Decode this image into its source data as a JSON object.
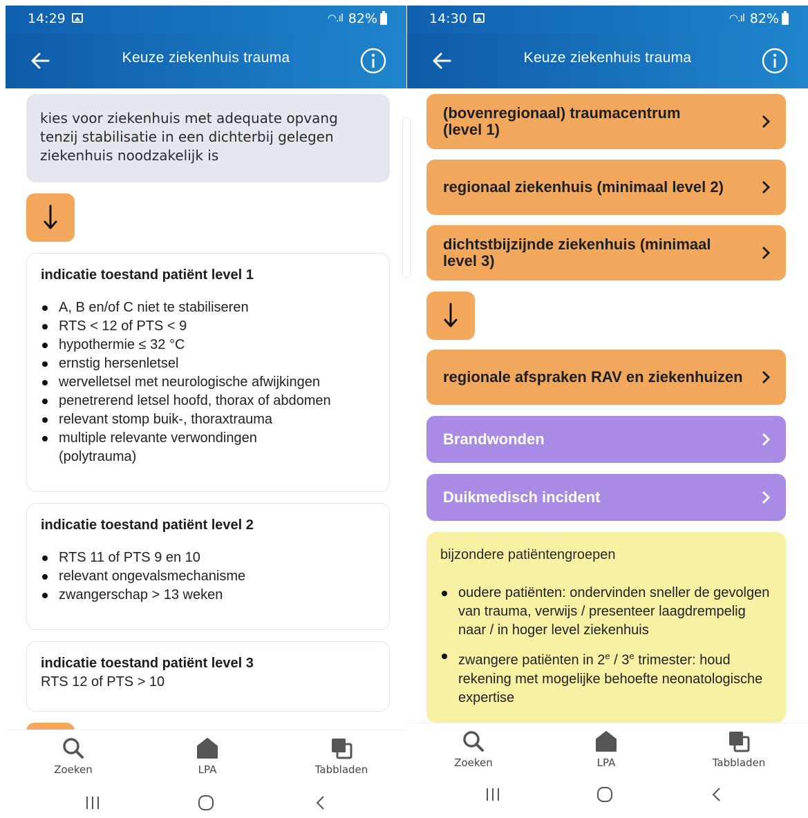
{
  "left": {
    "status": {
      "time": "14:29",
      "battery": "82%"
    },
    "app_title": "Keuze ziekenhuis trauma",
    "intro": "kies voor ziekenhuis met adequate opvang tenzij stabilisatie in een dichterbij gelegen ziekenhuis noodzakelijk is",
    "level1": {
      "title": "indicatie toestand patiënt level 1",
      "items": [
        "A, B en/of C niet te stabiliseren",
        "RTS < 12 of PTS < 9",
        "hypothermie ≤ 32 °C",
        "ernstig hersenletsel",
        "wervelletsel met neurologische afwijkingen",
        "penetrerend letsel hoofd, thorax of abdomen",
        "relevant stomp buik-, thoraxtrauma",
        "multiple relevante verwondingen (polytrauma)"
      ]
    },
    "level2": {
      "title": "indicatie toestand patiënt level 2",
      "items": [
        "RTS 11 of PTS 9 en 10",
        "relevant ongevalsmechanisme",
        "zwangerschap > 13 weken"
      ]
    },
    "level3": {
      "title": "indicatie toestand patiënt level 3",
      "text": "RTS 12 of PTS > 10"
    }
  },
  "right": {
    "status": {
      "time": "14:30",
      "battery": "82%"
    },
    "app_title": "Keuze ziekenhuis trauma",
    "buttons": {
      "b1": "(bovenregionaal) traumacentrum (level 1)",
      "b2": "regionaal ziekenhuis (minimaal level 2)",
      "b3": "dichtstbijzijnde ziekenhuis (minimaal level 3)",
      "b4": "regionale afspraken  RAV en ziekenhuizen",
      "b5": "Brandwonden",
      "b6": "Duikmedisch incident"
    },
    "special": {
      "title": "bijzondere patiëntengroepen",
      "item1": "oudere patiënten: ondervinden sneller de gevolgen van trauma, verwijs / presenteer laagdrempelig naar / in hoger level ziekenhuis",
      "item2_a": "zwangere patiënten in 2",
      "item2_sup1": "e",
      "item2_b": " / 3",
      "item2_sup2": "e",
      "item2_c": " trimester: houd rekening met mogelijke behoefte neonatologische expertise"
    }
  },
  "nav": {
    "search": "Zoeken",
    "lpa": "LPA",
    "tabs": "Tabbladen"
  },
  "colors": {
    "header": "#1565b8",
    "orange": "#f2a85c",
    "purple": "#a98be6",
    "yellow": "#f8f0a2",
    "intro_bg": "#e4e7ee"
  },
  "icons": [
    "arrow-left-icon",
    "info-icon",
    "arrow-down-icon",
    "chevron-right-icon",
    "search-icon",
    "home-icon",
    "tabs-icon"
  ]
}
